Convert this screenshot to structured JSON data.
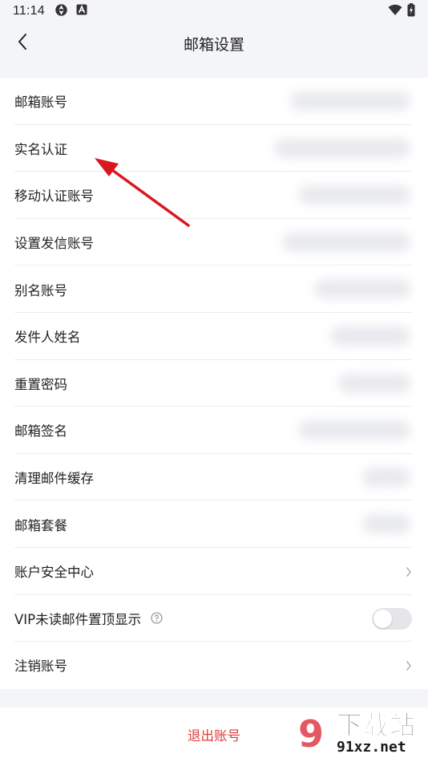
{
  "status_bar": {
    "time": "11:14",
    "icons": [
      "aperture-icon",
      "a-badge-icon",
      "wifi-icon",
      "battery-charging-icon"
    ]
  },
  "nav": {
    "title": "邮箱设置",
    "back_icon": "chevron-left-icon"
  },
  "settings": {
    "items": [
      {
        "label": "邮箱账号",
        "accessory": "blurred-value"
      },
      {
        "label": "实名认证",
        "accessory": "blurred-value"
      },
      {
        "label": "移动认证账号",
        "accessory": "blurred-value"
      },
      {
        "label": "设置发信账号",
        "accessory": "blurred-value"
      },
      {
        "label": "别名账号",
        "accessory": "blurred-value"
      },
      {
        "label": "发件人姓名",
        "accessory": "blurred-value"
      },
      {
        "label": "重置密码",
        "accessory": "blurred-value"
      },
      {
        "label": "邮箱签名",
        "accessory": "blurred-value"
      },
      {
        "label": "清理邮件缓存",
        "accessory": "blurred-value"
      },
      {
        "label": "邮箱套餐",
        "accessory": "blurred-value"
      },
      {
        "label": "账户安全中心",
        "accessory": "chevron-right-icon"
      },
      {
        "label": "VIP未读邮件置顶显示",
        "accessory": "toggle",
        "help_icon": "question-circle-icon",
        "toggle_on": false
      },
      {
        "label": "注销账号",
        "accessory": "chevron-right-icon"
      }
    ]
  },
  "logout": {
    "label": "退出账号",
    "color": "#e03c3c"
  },
  "annotation": {
    "arrow_color": "#d8181e"
  },
  "watermark": {
    "mark": "9",
    "title": "下载站",
    "url": "91xz.net"
  },
  "colors": {
    "background": "#f4f5f9",
    "surface": "#ffffff",
    "divider": "#ececec",
    "text": "#222222",
    "chevron": "#b0b0b0"
  }
}
